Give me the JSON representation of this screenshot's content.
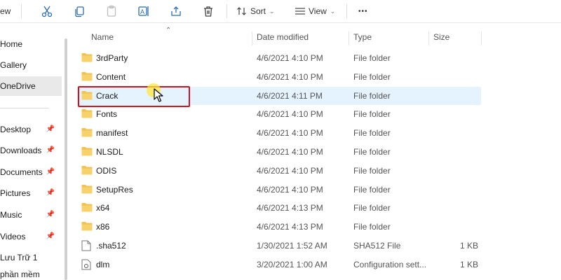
{
  "toolbar": {
    "view_partial": "ew",
    "sort_label": "Sort",
    "view_label": "View",
    "more_label": "•••"
  },
  "sidebar": {
    "items": [
      {
        "label": "Home"
      },
      {
        "label": "Gallery"
      },
      {
        "label": "OneDrive",
        "selected": true
      }
    ],
    "quick_access": [
      {
        "label": "Desktop"
      },
      {
        "label": "Downloads"
      },
      {
        "label": "Documents"
      },
      {
        "label": "Pictures"
      },
      {
        "label": "Music"
      },
      {
        "label": "Videos"
      },
      {
        "label": "Lưu Trữ 1"
      },
      {
        "label": "phần mềm"
      }
    ],
    "pin_glyph": "📌"
  },
  "columns": {
    "name": "Name",
    "date": "Date modified",
    "type": "Type",
    "size": "Size"
  },
  "files": [
    {
      "name": "3rdParty",
      "date": "4/6/2021 4:10 PM",
      "type": "File folder",
      "size": "",
      "icon": "folder-icon"
    },
    {
      "name": "Content",
      "date": "4/6/2021 4:10 PM",
      "type": "File folder",
      "size": "",
      "icon": "folder-icon"
    },
    {
      "name": "Crack",
      "date": "4/6/2021 4:11 PM",
      "type": "File folder",
      "size": "",
      "icon": "folder-icon",
      "hover": true
    },
    {
      "name": "Fonts",
      "date": "4/6/2021 4:10 PM",
      "type": "File folder",
      "size": "",
      "icon": "folder-icon"
    },
    {
      "name": "manifest",
      "date": "4/6/2021 4:10 PM",
      "type": "File folder",
      "size": "",
      "icon": "folder-icon"
    },
    {
      "name": "NLSDL",
      "date": "4/6/2021 4:10 PM",
      "type": "File folder",
      "size": "",
      "icon": "folder-icon"
    },
    {
      "name": "ODIS",
      "date": "4/6/2021 4:10 PM",
      "type": "File folder",
      "size": "",
      "icon": "folder-icon"
    },
    {
      "name": "SetupRes",
      "date": "4/6/2021 4:10 PM",
      "type": "File folder",
      "size": "",
      "icon": "folder-icon"
    },
    {
      "name": "x64",
      "date": "4/6/2021 4:13 PM",
      "type": "File folder",
      "size": "",
      "icon": "folder-icon"
    },
    {
      "name": "x86",
      "date": "4/6/2021 4:13 PM",
      "type": "File folder",
      "size": "",
      "icon": "folder-icon"
    },
    {
      "name": ".sha512",
      "date": "1/30/2021 1:52 AM",
      "type": "SHA512 File",
      "size": "1 KB",
      "icon": "file-icon"
    },
    {
      "name": "dlm",
      "date": "3/20/2021 1:00 AM",
      "type": "Configuration sett...",
      "size": "1 KB",
      "icon": "config-file-icon"
    }
  ],
  "colors": {
    "folder": "#f2c14e",
    "hover_row": "#e5f3ff",
    "selected_nav": "#e9e9e9",
    "highlight": "#d0121e"
  }
}
